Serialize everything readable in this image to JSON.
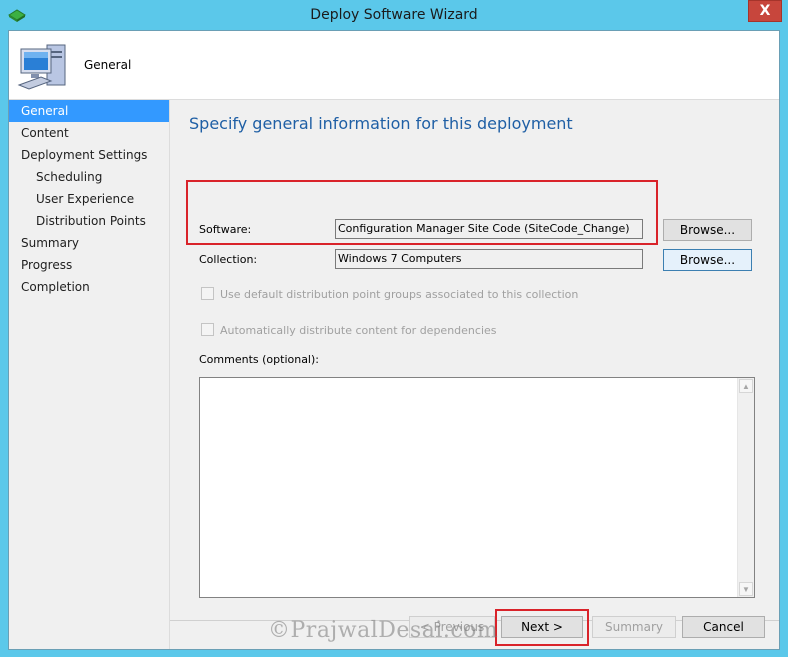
{
  "window": {
    "title": "Deploy Software Wizard",
    "close_glyph": "X"
  },
  "header": {
    "label": "General",
    "icon": "computer-icon"
  },
  "nav": {
    "items": [
      {
        "label": "General",
        "active": true
      },
      {
        "label": "Content"
      },
      {
        "label": "Deployment Settings"
      },
      {
        "label": "Scheduling",
        "sub": true
      },
      {
        "label": "User Experience",
        "sub": true
      },
      {
        "label": "Distribution Points",
        "sub": true
      },
      {
        "label": "Summary"
      },
      {
        "label": "Progress"
      },
      {
        "label": "Completion"
      }
    ]
  },
  "main": {
    "heading": "Specify general information for this deployment",
    "software_label": "Software:",
    "software_value": "Configuration Manager Site Code (SiteCode_Change)",
    "collection_label": "Collection:",
    "collection_value": "Windows 7 Computers",
    "browse_label": "Browse...",
    "checkbox_default_dp": "Use default distribution point groups associated to this collection",
    "checkbox_auto_distribute": "Automatically distribute content for dependencies",
    "comments_label": "Comments (optional):"
  },
  "footer": {
    "previous_label": "< Previous",
    "next_label": "Next >",
    "summary_label": "Summary",
    "cancel_label": "Cancel"
  },
  "watermark": "©PrajwalDesai.com",
  "colors": {
    "titlebar": "#5bc8ea",
    "accent_heading": "#1f5fa5",
    "nav_active": "#3399ff",
    "highlight_red": "#d9232a",
    "close_button": "#c7463c"
  }
}
